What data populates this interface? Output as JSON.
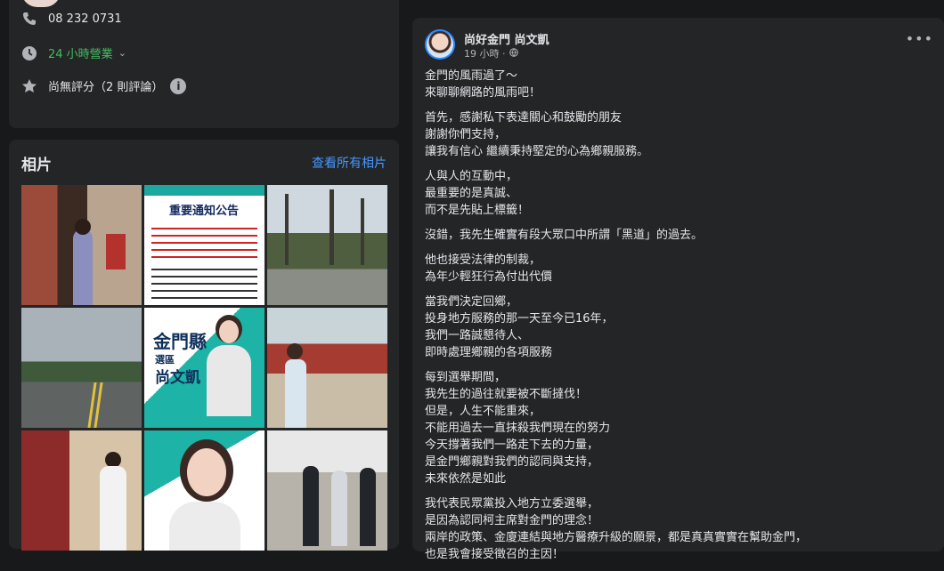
{
  "info": {
    "phone": "08 232 0731",
    "hours": "24 小時營業",
    "rating": "尚無評分（2 則評論）"
  },
  "photos": {
    "title": "相片",
    "see_all": "查看所有相片",
    "notice_title": "重要通知公告",
    "poster_county": "金門縣",
    "poster_district": "選區",
    "poster_name": "尚文凱"
  },
  "post": {
    "author": "尚好金門 尚文凱",
    "time": "19 小時 ·",
    "paragraphs": [
      "金門的風雨過了～\n來聊聊網路的風雨吧！",
      "首先，感謝私下表達關心和鼓勵的朋友\n謝謝你們支持，\n讓我有信心 繼續秉持堅定的心為鄉親服務。",
      "人與人的互動中，\n最重要的是真誠、\n而不是先貼上標籤！",
      "沒錯，我先生確實有段大眾口中所謂「黑道」的過去。",
      "他也接受法律的制裁，\n為年少輕狂行為付出代價",
      "當我們決定回鄉，\n投身地方服務的那一天至今已16年，\n我們一路誠懇待人、\n即時處理鄉親的各項服務",
      "每到選舉期間，\n我先生的過往就要被不斷撻伐！\n但是，人生不能重來，\n不能用過去一直抹殺我們現在的努力\n今天撐著我們一路走下去的力量，\n是金門鄉親對我們的認同與支持，\n未來依然是如此",
      "我代表民眾黨投入地方立委選舉，\n是因為認同柯主席對金門的理念！\n兩岸的政策、金廈連結與地方醫療升級的願景，都是真真實實在幫助金門，\n也是我會接受徵召的主因！"
    ]
  }
}
